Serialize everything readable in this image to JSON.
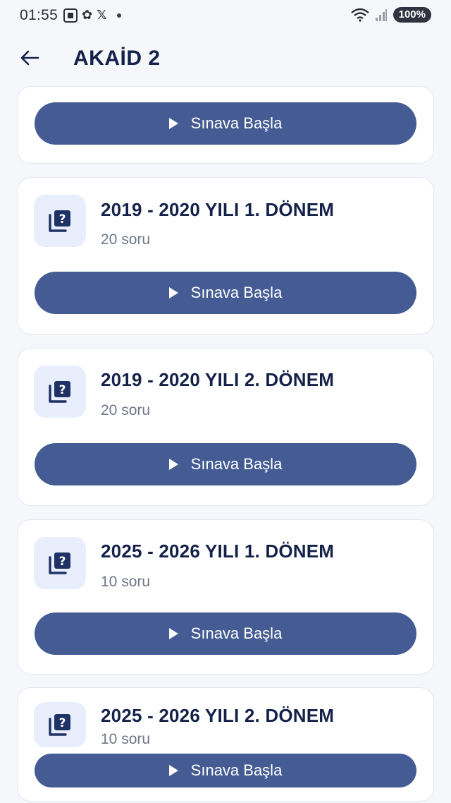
{
  "status_bar": {
    "time": "01:55",
    "battery": "100%"
  },
  "app_bar": {
    "title": "AKAİD 2"
  },
  "first_card": {
    "button_label": "Sınava Başla"
  },
  "exams": [
    {
      "title": "2019 - 2020 YILI 1. DÖNEM",
      "count": "20 soru",
      "button_label": "Sınava Başla"
    },
    {
      "title": "2019 - 2020 YILI 2. DÖNEM",
      "count": "20 soru",
      "button_label": "Sınava Başla"
    },
    {
      "title": "2025 - 2026 YILI 1. DÖNEM",
      "count": "10 soru",
      "button_label": "Sınava Başla"
    },
    {
      "title": "2025 - 2026 YILI 2. DÖNEM",
      "count": "10 soru",
      "button_label": "Sınava Başla"
    }
  ],
  "colors": {
    "accent": "#445c93",
    "title": "#14224a",
    "icon_bg": "#e8eefc"
  }
}
